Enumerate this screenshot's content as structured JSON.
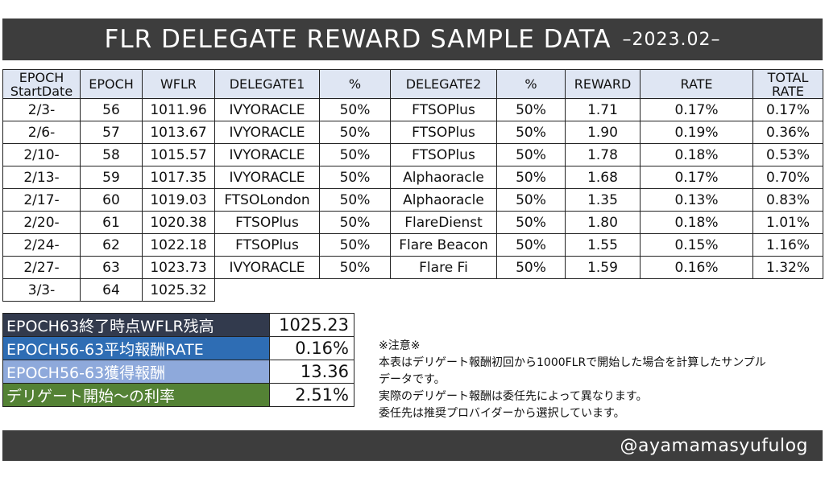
{
  "header": {
    "title": "FLR  DELEGATE  REWARD  SAMPLE DATA",
    "subtitle": "–2023.02–"
  },
  "table": {
    "columns": [
      [
        "EPOCH",
        "StartDate"
      ],
      [
        "EPOCH"
      ],
      [
        "WFLR"
      ],
      [
        "DELEGATE1"
      ],
      [
        "%"
      ],
      [
        "DELEGATE2"
      ],
      [
        "%"
      ],
      [
        "REWARD"
      ],
      [
        "RATE"
      ],
      [
        "TOTAL",
        "RATE"
      ]
    ],
    "rows": [
      [
        "2/3-",
        "56",
        "1011.96",
        "IVYORACLE",
        "50%",
        "FTSOPlus",
        "50%",
        "1.71",
        "0.17%",
        "0.17%"
      ],
      [
        "2/6-",
        "57",
        "1013.67",
        "IVYORACLE",
        "50%",
        "FTSOPlus",
        "50%",
        "1.90",
        "0.19%",
        "0.36%"
      ],
      [
        "2/10-",
        "58",
        "1015.57",
        "IVYORACLE",
        "50%",
        "FTSOPlus",
        "50%",
        "1.78",
        "0.18%",
        "0.53%"
      ],
      [
        "2/13-",
        "59",
        "1017.35",
        "IVYORACLE",
        "50%",
        "Alphaoracle",
        "50%",
        "1.68",
        "0.17%",
        "0.70%"
      ],
      [
        "2/17-",
        "60",
        "1019.03",
        "FTSOLondon",
        "50%",
        "Alphaoracle",
        "50%",
        "1.35",
        "0.13%",
        "0.83%"
      ],
      [
        "2/20-",
        "61",
        "1020.38",
        "FTSOPlus",
        "50%",
        "FlareDienst",
        "50%",
        "1.80",
        "0.18%",
        "1.01%"
      ],
      [
        "2/24-",
        "62",
        "1022.18",
        "FTSOPlus",
        "50%",
        "Flare Beacon",
        "50%",
        "1.55",
        "0.15%",
        "1.16%"
      ],
      [
        "2/27-",
        "63",
        "1023.73",
        "IVYORACLE",
        "50%",
        "Flare Fi",
        "50%",
        "1.59",
        "0.16%",
        "1.32%"
      ],
      [
        "3/3-",
        "64",
        "1025.32"
      ]
    ]
  },
  "summary": [
    {
      "label": "EPOCH63終了時点WFLR残高",
      "value": "1025.23",
      "color": "#323a4d"
    },
    {
      "label": "EPOCH56-63平均報酬RATE",
      "value": "0.16%",
      "color": "#2e6db4"
    },
    {
      "label": "EPOCH56-63獲得報酬",
      "value": "13.36",
      "color": "#8ea9db"
    },
    {
      "label": "デリゲート開始～の利率",
      "value": "2.51%",
      "color": "#548235"
    }
  ],
  "notes": [
    "※注意※",
    "本表はデリゲート報酬初回から1000FLRで開始した場合を計算したサンプル",
    "データです。",
    "実際のデリゲート報酬は委任先によって異なります。",
    "委任先は推奨プロバイダーから選択しています。"
  ],
  "footer": {
    "handle": "@ayamamasyufulog"
  },
  "colors": {
    "banner": "#3d3d3d",
    "header_fill": "#dfe6f3"
  }
}
